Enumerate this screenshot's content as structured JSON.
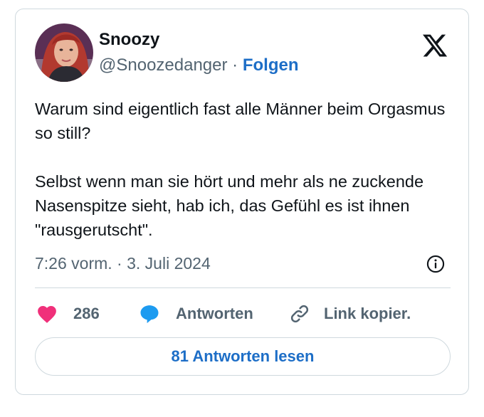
{
  "tweet": {
    "author": {
      "name": "Snoozy",
      "handle": "@Snoozedanger",
      "separator": "·",
      "follow_label": "Folgen"
    },
    "text_paragraphs": [
      "Warum sind eigentlich fast alle Männer beim Orgasmus so still?",
      "Selbst wenn man sie hört und mehr als ne zuckende Nasenspitze sieht, hab ich, das Gefühl es ist ihnen \"rausgerutscht\"."
    ],
    "timestamp": "7:26 vorm. · 3. Juli 2024",
    "actions": {
      "likes": "286",
      "reply_label": "Antworten",
      "copy_link_label": "Link kopier."
    },
    "read_replies_label": "81 Antworten lesen"
  },
  "icons": {
    "platform_logo": "x-logo-icon",
    "info": "info-icon",
    "like": "heart-icon",
    "reply": "speech-bubble-icon",
    "link": "link-icon"
  },
  "colors": {
    "text": "#0f1419",
    "secondary": "#536471",
    "accent": "#1d6ec7",
    "heart": "#f0307a",
    "reply_bubble": "#1d9bf0",
    "border": "#cfd9de"
  }
}
